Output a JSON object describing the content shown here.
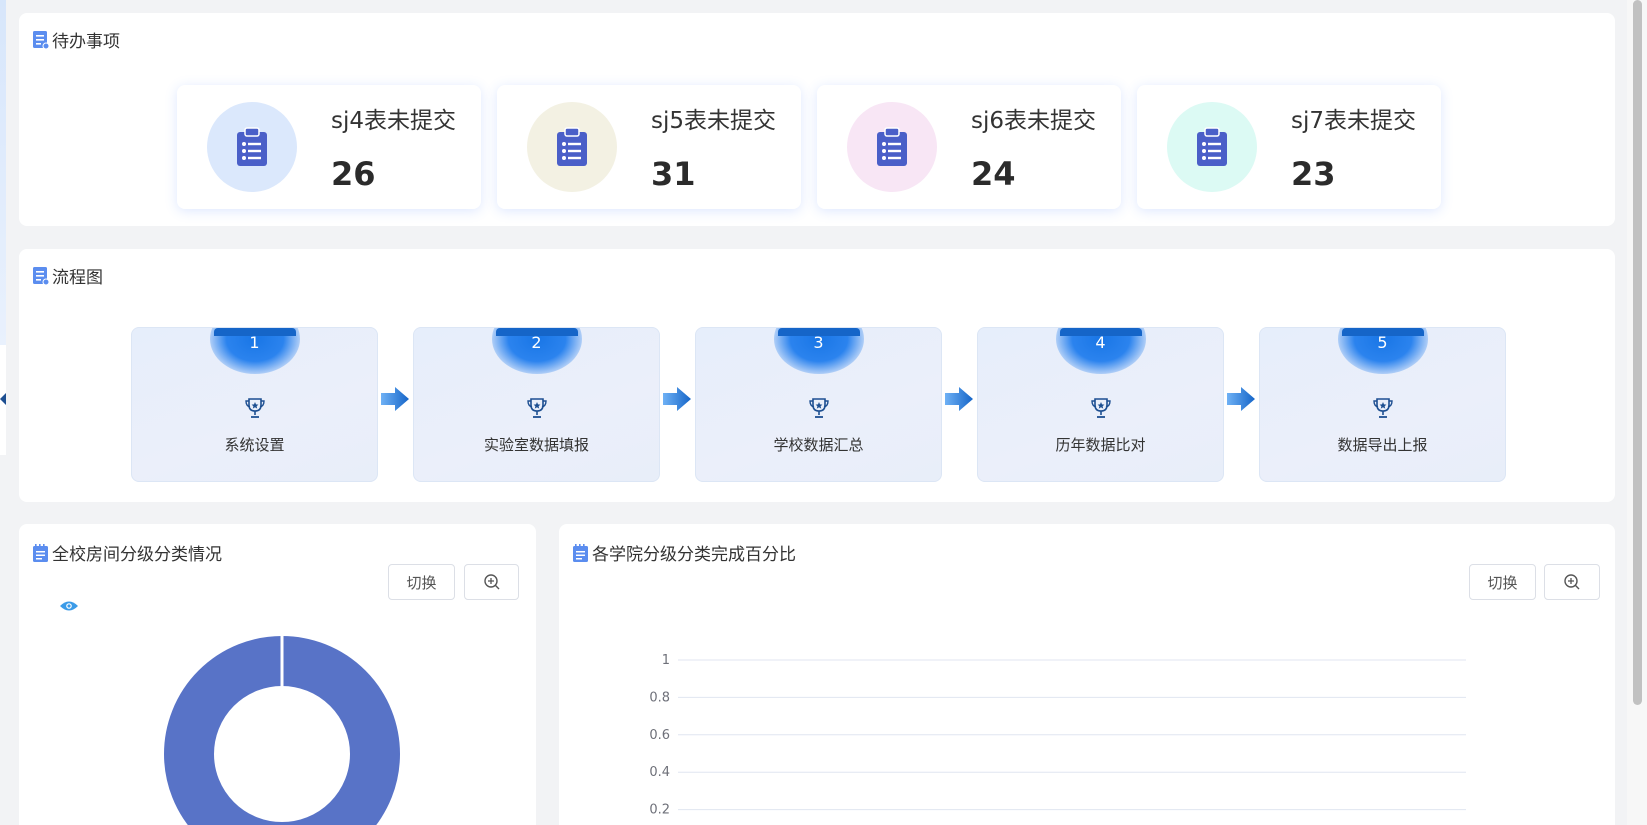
{
  "todo": {
    "title": "待办事项",
    "items": [
      {
        "label": "sj4表未提交",
        "count": "26",
        "circle_color": "#dbe8fc"
      },
      {
        "label": "sj5表未提交",
        "count": "31",
        "circle_color": "#f3f1e3"
      },
      {
        "label": "sj6表未提交",
        "count": "24",
        "circle_color": "#f8e6f5"
      },
      {
        "label": "sj7表未提交",
        "count": "23",
        "circle_color": "#dcfaf4"
      }
    ]
  },
  "flow": {
    "title": "流程图",
    "steps": [
      {
        "num": "1",
        "label": "系统设置"
      },
      {
        "num": "2",
        "label": "实验室数据填报"
      },
      {
        "num": "3",
        "label": "学校数据汇总"
      },
      {
        "num": "4",
        "label": "历年数据比对"
      },
      {
        "num": "5",
        "label": "数据导出上报"
      }
    ]
  },
  "room_panel": {
    "title": "全校房间分级分类情况",
    "switch_label": "切换"
  },
  "college_panel": {
    "title": "各学院分级分类完成百分比",
    "switch_label": "切换"
  },
  "colors": {
    "accent": "#1565c8",
    "icon_blue": "#4a5fc8",
    "donut": "#5873c7",
    "legend_eye": "#3b9be8"
  },
  "chart_data": [
    {
      "type": "pie",
      "title": "",
      "labels": [
        ""
      ],
      "values": [
        100
      ],
      "legend": "top-left"
    },
    {
      "type": "bar",
      "title": "",
      "xlabel": "",
      "ylabel": "",
      "ylim": [
        0,
        1
      ],
      "yticks": [
        "1",
        "0.8",
        "0.6",
        "0.4",
        "0.2"
      ],
      "categories": [],
      "values": [],
      "grid": true
    }
  ]
}
